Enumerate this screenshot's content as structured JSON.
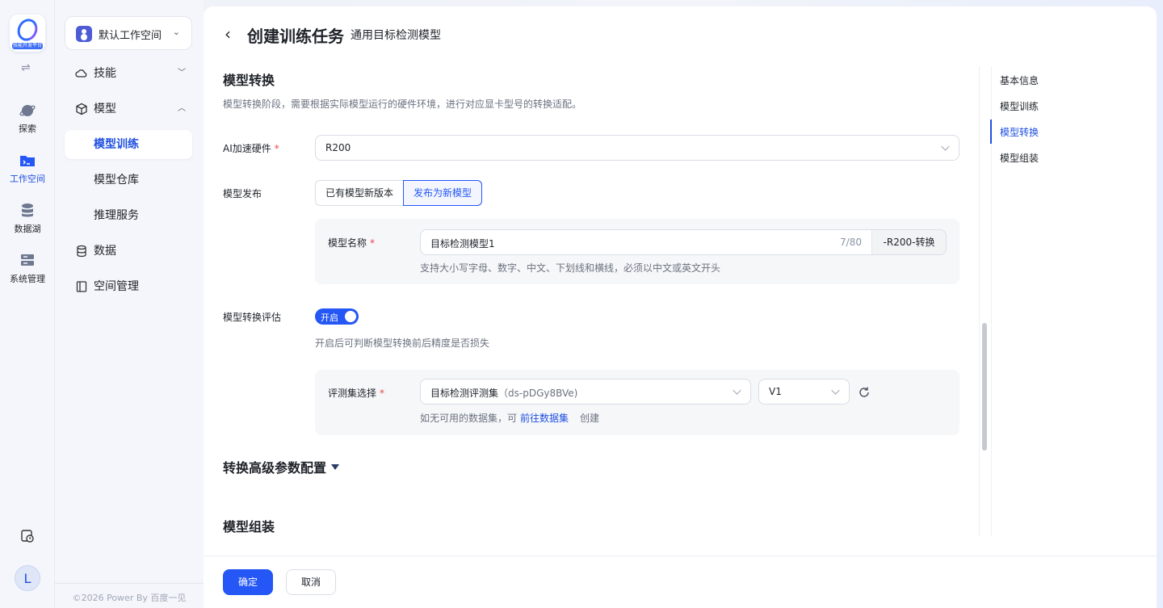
{
  "colors": {
    "primary": "#2457f5",
    "accent_text": "#1f4fe0",
    "required": "#e5484d"
  },
  "rail": {
    "logo_caption": "技能开发平台",
    "items": [
      {
        "label": "探索",
        "icon": "planet-icon"
      },
      {
        "label": "工作空间",
        "icon": "terminal-folder-icon"
      },
      {
        "label": "数据湖",
        "icon": "database-icon"
      },
      {
        "label": "系统管理",
        "icon": "server-icon"
      }
    ],
    "avatar_letter": "L"
  },
  "nav": {
    "workspace": "默认工作空间",
    "items": {
      "skills": "技能",
      "model": "模型",
      "model_training": "模型训练",
      "model_repo": "模型仓库",
      "inference": "推理服务",
      "data": "数据",
      "space_mgmt": "空间管理"
    },
    "copyright": "©2026 Power By 百度一见"
  },
  "header": {
    "title": "创建训练任务",
    "subtitle": "通用目标检测模型"
  },
  "section": {
    "title": "模型转换",
    "desc": "模型转换阶段，需要根据实际模型运行的硬件环境，进行对应显卡型号的转换适配。"
  },
  "form": {
    "hw_label": "AI加速硬件",
    "hw_value": "R200",
    "publish_label": "模型发布",
    "publish_opt1": "已有模型新版本",
    "publish_opt2": "发布为新模型",
    "name_label": "模型名称",
    "name_value": "目标检测模型1",
    "name_count": "7/80",
    "name_suffix": "-R200-转换",
    "name_hint": "支持大小写字母、数字、中文、下划线和横线，必须以中文或英文开头",
    "eval_label": "模型转换评估",
    "eval_toggle": "开启",
    "eval_desc": "开启后可判断模型转换前后精度是否损失",
    "evalset_label": "评测集选择",
    "evalset_value": "目标检测评测集",
    "evalset_id": "（ds-pDGy8BVe)",
    "version_value": "V1",
    "evalset_hint": "如无可用的数据集，可",
    "evalset_link": "前往数据集",
    "evalset_create": "创建",
    "advanced": "转换高级参数配置",
    "next_section": "模型组装"
  },
  "anchor": [
    "基本信息",
    "模型训练",
    "模型转换",
    "模型组装"
  ],
  "footer": {
    "confirm": "确定",
    "cancel": "取消"
  }
}
